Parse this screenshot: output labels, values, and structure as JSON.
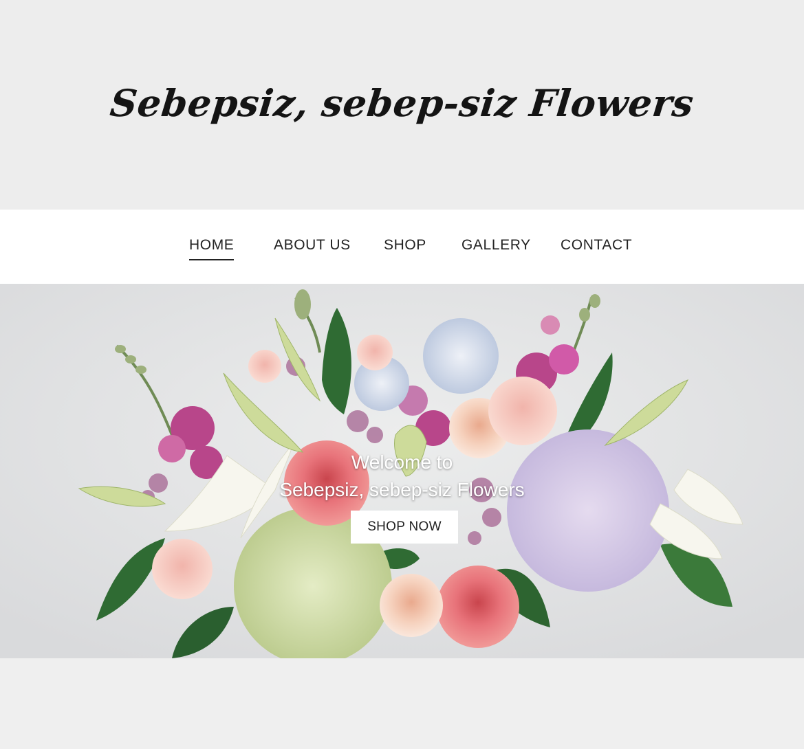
{
  "header": {
    "title": "Sebepsiz, sebep-siz Flowers"
  },
  "nav": {
    "items": [
      {
        "label": "HOME",
        "active": true
      },
      {
        "label": "ABOUT US",
        "active": false
      },
      {
        "label": "SHOP",
        "active": false
      },
      {
        "label": "GALLERY",
        "active": false
      },
      {
        "label": "CONTACT",
        "active": false
      }
    ]
  },
  "hero": {
    "line1": "Welcome to",
    "line2": "Sebepsiz, sebep-siz Flowers",
    "button_label": "SHOP NOW",
    "image": "flower-bouquet-image"
  },
  "colors": {
    "background": "#efefef",
    "nav_background": "#ffffff",
    "text": "#222222",
    "hero_text": "#ffffff"
  }
}
